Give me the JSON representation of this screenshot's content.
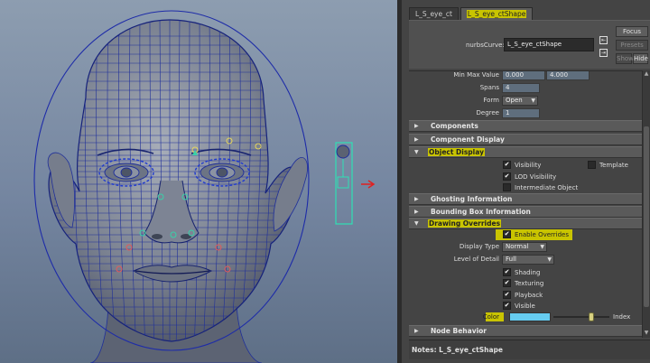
{
  "tabs": [
    {
      "label": "L_S_eye_ct"
    },
    {
      "label": "L_S_eye_ctShape",
      "active": true
    }
  ],
  "node": {
    "type_label": "nurbsCurve:",
    "name": "L_S_eye_ctShape",
    "buttons": {
      "focus": "Focus",
      "presets": "Presets",
      "show": "Show",
      "hide": "Hide"
    }
  },
  "attrs": {
    "minmax_label": "Min Max Value",
    "min_value": "0.000",
    "max_value": "4.000",
    "spans_label": "Spans",
    "spans_value": "4",
    "form_label": "Form",
    "form_value": "Open",
    "degree_label": "Degree",
    "degree_value": "1"
  },
  "sections": {
    "components": "Components",
    "component_display": "Component Display",
    "object_display": "Object Display",
    "ghosting": "Ghosting Information",
    "bounding_box": "Bounding Box Information",
    "drawing_overrides": "Drawing Overrides",
    "node_behavior": "Node Behavior"
  },
  "object_display": {
    "visibility": "Visibility",
    "template": "Template",
    "lod_visibility": "LOD Visibility",
    "intermediate": "Intermediate Object"
  },
  "drawing_overrides": {
    "enable_overrides": "Enable Overrides",
    "display_type_label": "Display Type",
    "display_type_value": "Normal",
    "lod_label": "Level of Detail",
    "lod_value": "Full",
    "shading": "Shading",
    "texturing": "Texturing",
    "playback": "Playback",
    "visible": "Visible",
    "color_label": "Color",
    "index_label": "Index",
    "color_hex": "#66ccf0"
  },
  "notes": {
    "label": "Notes:  L_S_eye_ctShape"
  },
  "colors": {
    "highlight": "#c9c400",
    "wire": "#1f2f9a",
    "control": "#2fe0b4"
  }
}
